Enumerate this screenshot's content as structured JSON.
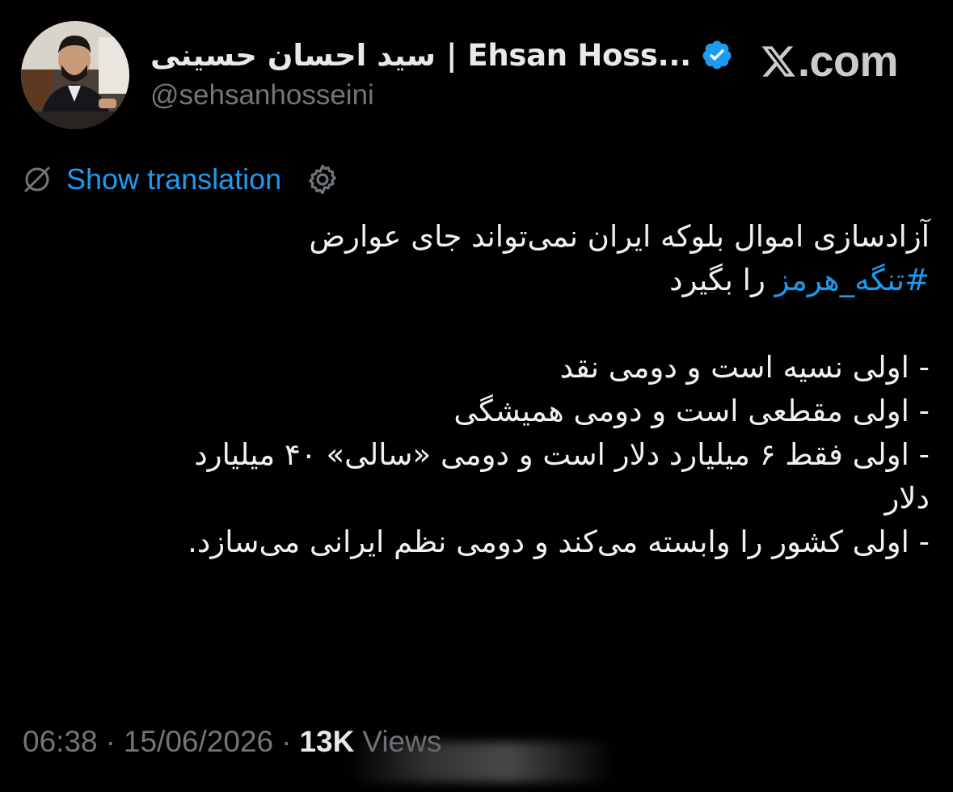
{
  "author": {
    "display_name": "سید احسان حسینی | Ehsan Hoss...",
    "handle": "@sehsanhosseini",
    "verified": true
  },
  "brand": {
    "site": ".com",
    "logo": "x-logo"
  },
  "translation": {
    "label": "Show translation",
    "translate_icon": "translate-off-icon",
    "settings_icon": "gear-icon"
  },
  "tweet": {
    "line1": "آزادسازی اموال بلوکه ایران نمی‌تواند جای عوارض",
    "hashtag": "#تنگه_هرمز",
    "line2_rest": " را بگیرد",
    "point1": "- اولی نسیه است و دومی نقد",
    "point2": "- اولی مقطعی است و دومی همیشگی",
    "point3a": "- اولی فقط ۶ میلیارد دلار است و دومی «سالی» ۴۰ میلیارد",
    "point3b": "دلار",
    "point4": "- اولی کشور را وابسته می‌کند و دومی نظم ایرانی می‌سازد."
  },
  "meta": {
    "time": "06:38",
    "date": "15/06/2026",
    "separator": "·",
    "views_count": "13K",
    "views_label": "Views"
  },
  "colors": {
    "background": "#000000",
    "accent": "#1d9bf0",
    "secondary_text": "#71767b",
    "primary_text": "#e7e9ea"
  }
}
